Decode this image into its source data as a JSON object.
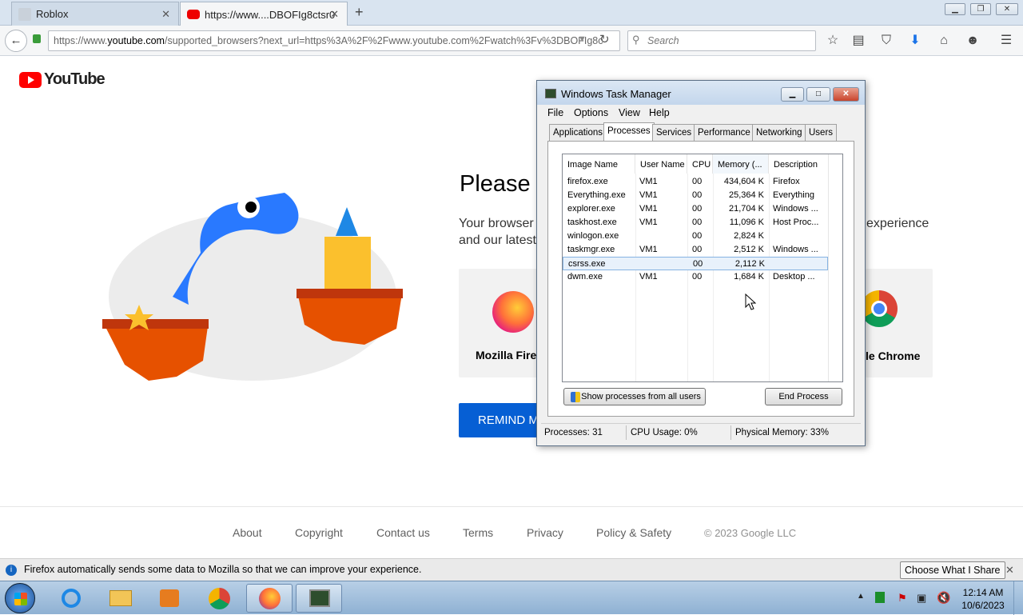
{
  "browser": {
    "tabs": [
      {
        "label": "Roblox"
      },
      {
        "label": "https://www....DBOFIg8ctsr0"
      }
    ],
    "url": {
      "prefix": "https://www.",
      "domain": "youtube.com",
      "rest": "/supported_browsers?next_url=https%3A%2F%2Fwww.youtube.com%2Fwatch%3Fv%3DBOFIg8c"
    },
    "search_placeholder": "Search"
  },
  "page": {
    "logo_text": "YouTube",
    "heading": "Please u",
    "body_line1": "Your browser",
    "body_line1_end": "experience",
    "body_line2": "and our latest",
    "browser_cards": [
      {
        "label": "Mozilla Fire"
      },
      {
        "label": "le Chrome"
      }
    ],
    "remind_button": "REMIND M",
    "footer": {
      "links": [
        "About",
        "Copyright",
        "Contact us",
        "Terms",
        "Privacy",
        "Policy & Safety"
      ],
      "copyright": "© 2023 Google LLC"
    }
  },
  "notification": {
    "text": "Firefox automatically sends some data to Mozilla so that we can improve your experience.",
    "button": "Choose What I Share"
  },
  "taskbar": {
    "time": "12:14 AM",
    "date": "10/6/2023"
  },
  "task_manager": {
    "title": "Windows Task Manager",
    "menu": [
      "File",
      "Options",
      "View",
      "Help"
    ],
    "tabs": [
      "Applications",
      "Processes",
      "Services",
      "Performance",
      "Networking",
      "Users"
    ],
    "selected_tab": "Processes",
    "columns": [
      "Image Name",
      "User Name",
      "CPU",
      "Memory (...",
      "Description"
    ],
    "rows": [
      {
        "name": "firefox.exe",
        "user": "VM1",
        "cpu": "00",
        "mem": "434,604 K",
        "desc": "Firefox"
      },
      {
        "name": "Everything.exe",
        "user": "VM1",
        "cpu": "00",
        "mem": "25,364 K",
        "desc": "Everything"
      },
      {
        "name": "explorer.exe",
        "user": "VM1",
        "cpu": "00",
        "mem": "21,704 K",
        "desc": "Windows ..."
      },
      {
        "name": "taskhost.exe",
        "user": "VM1",
        "cpu": "00",
        "mem": "11,096 K",
        "desc": "Host Proc..."
      },
      {
        "name": "winlogon.exe",
        "user": "",
        "cpu": "00",
        "mem": "2,824 K",
        "desc": ""
      },
      {
        "name": "taskmgr.exe",
        "user": "VM1",
        "cpu": "00",
        "mem": "2,512 K",
        "desc": "Windows ..."
      },
      {
        "name": "csrss.exe",
        "user": "",
        "cpu": "00",
        "mem": "2,112 K",
        "desc": ""
      },
      {
        "name": "dwm.exe",
        "user": "VM1",
        "cpu": "00",
        "mem": "1,684 K",
        "desc": "Desktop ..."
      }
    ],
    "selected_row": "csrss.exe",
    "show_all_button": "Show processes from all users",
    "end_process_button": "End Process",
    "status": {
      "processes": "Processes: 31",
      "cpu": "CPU Usage: 0%",
      "memory": "Physical Memory: 33%"
    }
  }
}
